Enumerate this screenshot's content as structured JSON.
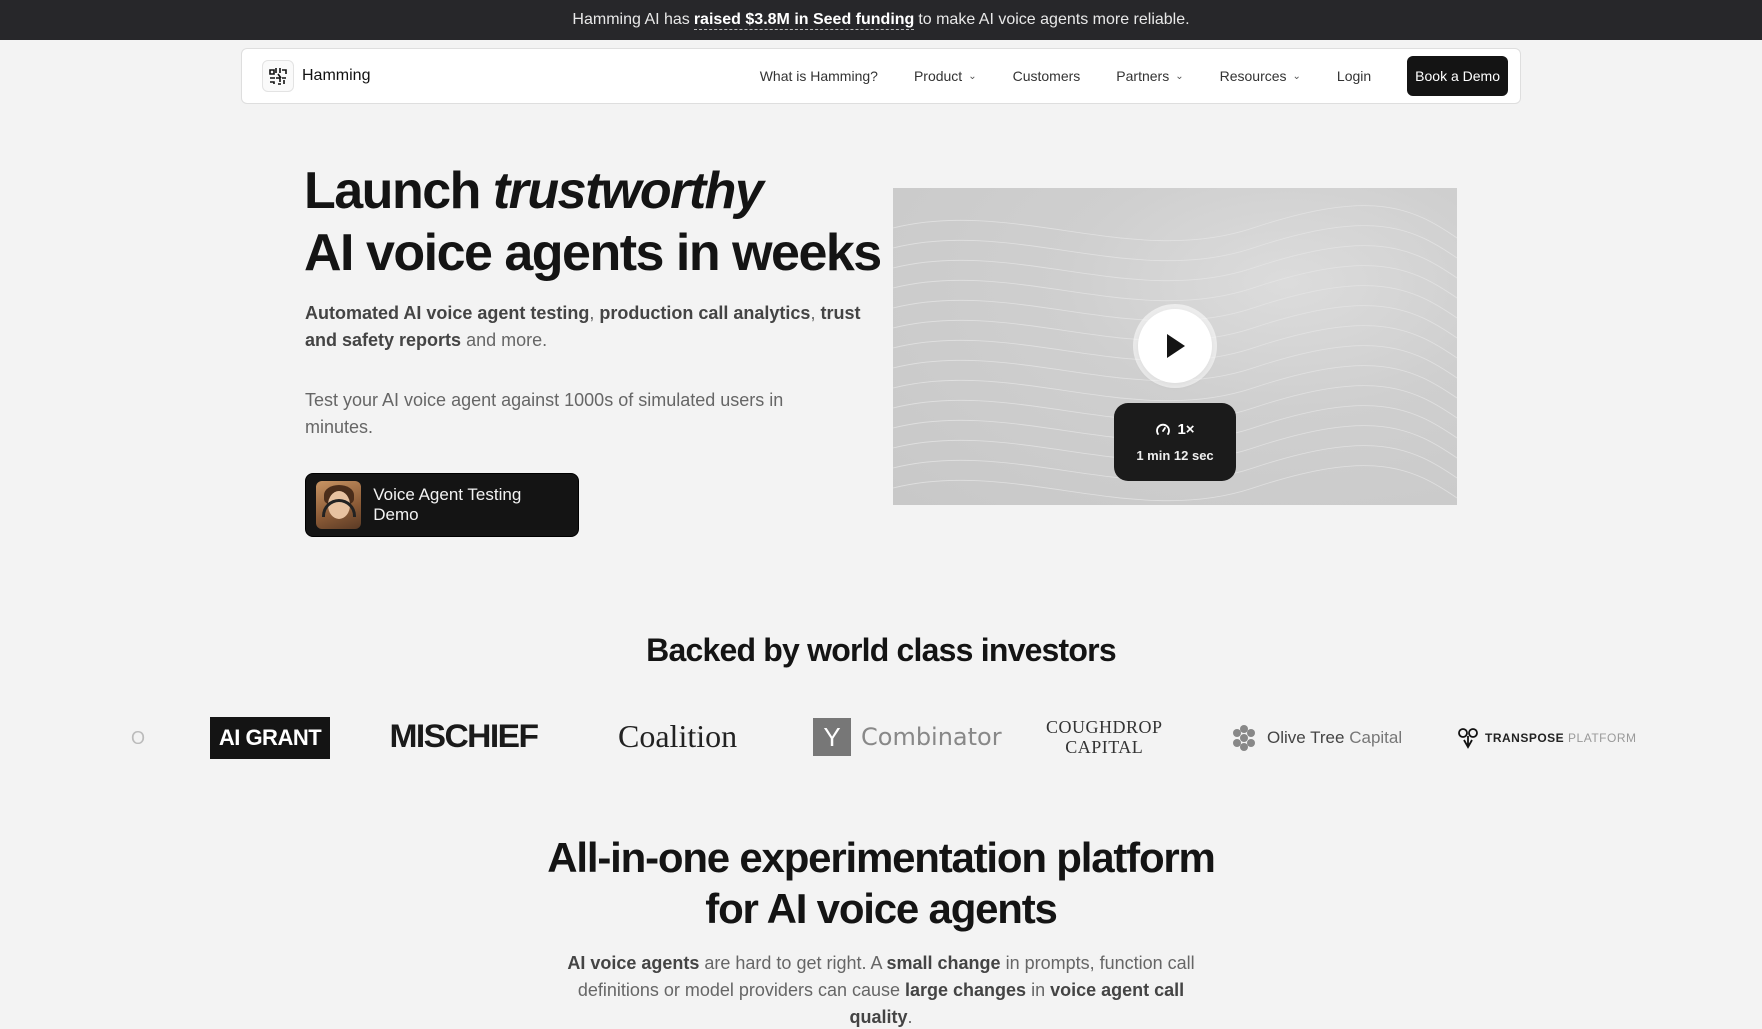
{
  "announcement": {
    "pre": "Hamming AI has",
    "link": "raised $3.8M in Seed funding",
    "post": "to make AI voice agents more reliable."
  },
  "nav": {
    "brand": "Hamming",
    "items": [
      {
        "label": "What is Hamming?",
        "dropdown": false
      },
      {
        "label": "Product",
        "dropdown": true
      },
      {
        "label": "Customers",
        "dropdown": false
      },
      {
        "label": "Partners",
        "dropdown": true
      },
      {
        "label": "Resources",
        "dropdown": true
      },
      {
        "label": "Login",
        "dropdown": false
      }
    ],
    "cta": "Book a Demo"
  },
  "hero": {
    "title_line1_a": "Launch ",
    "title_line1_em": "trustworthy",
    "title_line2": "AI voice agents in weeks",
    "sub_b1": "Automated AI voice agent testing",
    "sub_sep1": ", ",
    "sub_b2": "production call analytics",
    "sub_sep2": ", ",
    "sub_b3": "trust and safety reports",
    "sub_end": " and more.",
    "sub2": "Test your AI voice agent against 1000s of simulated users in minutes.",
    "demo_button": "Voice Agent Testing Demo"
  },
  "video": {
    "speed": "1×",
    "duration": "1 min 12 sec"
  },
  "investors": {
    "title": "Backed by world class investors",
    "logos": {
      "partial": "O",
      "aigrant": "AI GRANT",
      "mischief": "MISCHIEF",
      "coalition": "Coalition",
      "yc_mark": "Y",
      "yc_text": "Combinator",
      "cough_line1": "COUGHDROP",
      "cough_line2": "CAPITAL",
      "olive_name": "Olive Tree",
      "olive_cap": "Capital",
      "transpose_a": "TRANSPOSE",
      "transpose_b": "PLATFORM"
    }
  },
  "platform": {
    "title_line1": "All-in-one experimentation platform",
    "title_line2": "for AI voice agents",
    "s_b1": "AI voice agents",
    "s_t1": " are hard to get right. A ",
    "s_b2": "small change",
    "s_t2": " in prompts, function call definitions or model providers can cause ",
    "s_b3": "large changes",
    "s_t3": " in ",
    "s_b4": "voice agent call quality",
    "s_t4": "."
  },
  "colors": {
    "announce_bg": "#27272a",
    "page_bg": "#f3f3f3",
    "cta_bg": "#141414"
  },
  "icons": [
    "hamming-logo-icon",
    "chevron-down-icon",
    "play-icon",
    "speed-gauge-icon",
    "olive-tree-icon",
    "transpose-icon"
  ]
}
